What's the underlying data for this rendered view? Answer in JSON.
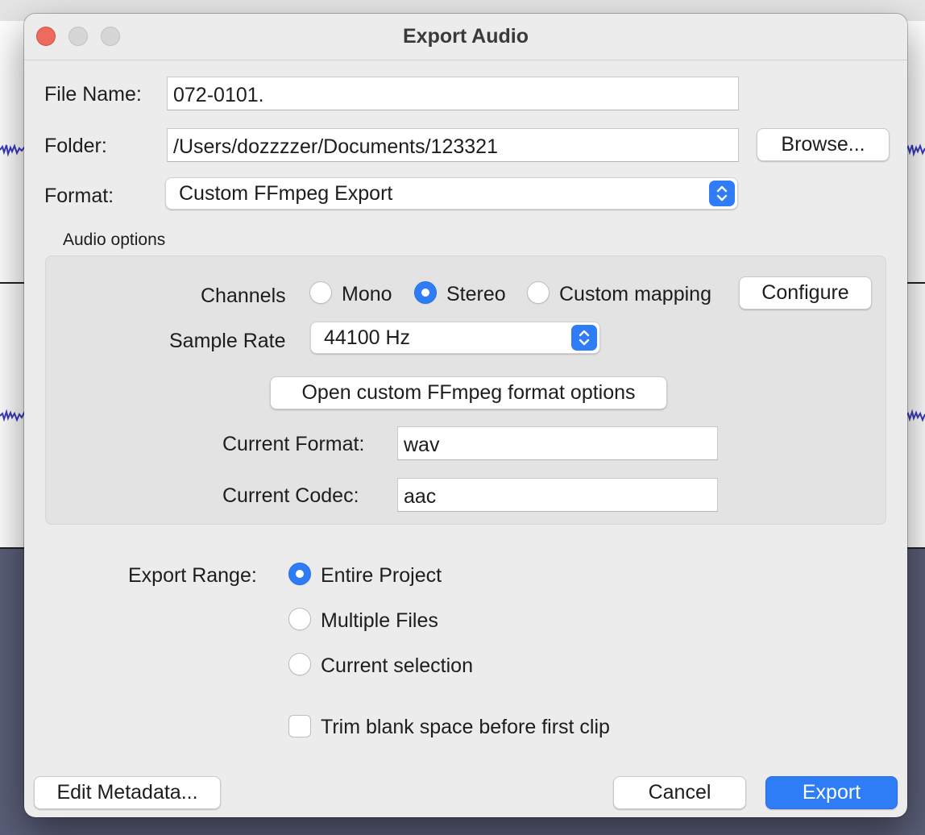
{
  "dialog": {
    "title": "Export Audio"
  },
  "file": {
    "name_label": "File Name:",
    "name_value": "072-0101.",
    "folder_label": "Folder:",
    "folder_value": "/Users/dozzzzer/Documents/123321",
    "browse_label": "Browse...",
    "format_label": "Format:",
    "format_value": "Custom FFmpeg Export"
  },
  "audio_options": {
    "heading": "Audio options",
    "channels_label": "Channels",
    "channels": [
      {
        "label": "Mono",
        "selected": false
      },
      {
        "label": "Stereo",
        "selected": true
      },
      {
        "label": "Custom mapping",
        "selected": false
      }
    ],
    "configure_label": "Configure",
    "sample_rate_label": "Sample Rate",
    "sample_rate_value": "44100 Hz",
    "ffmpeg_options_label": "Open custom FFmpeg format options",
    "current_format_label": "Current Format:",
    "current_format_value": "wav",
    "current_codec_label": "Current Codec:",
    "current_codec_value": "aac"
  },
  "export_range": {
    "label": "Export Range:",
    "options": [
      {
        "label": "Entire Project",
        "selected": true
      },
      {
        "label": "Multiple Files",
        "selected": false
      },
      {
        "label": "Current selection",
        "selected": false
      }
    ],
    "trim_label": "Trim blank space before first clip",
    "trim_checked": false
  },
  "buttons": {
    "edit_metadata": "Edit Metadata...",
    "cancel": "Cancel",
    "export": "Export"
  },
  "colors": {
    "accent": "#2e7cf6",
    "close": "#ed6a5e",
    "dialog_bg": "#ececec"
  }
}
